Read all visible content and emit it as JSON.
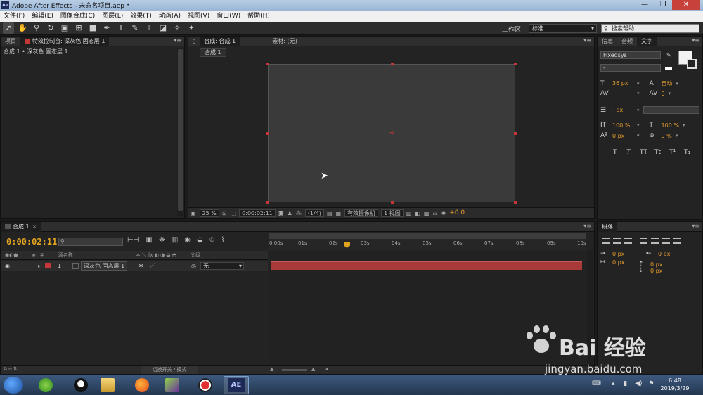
{
  "window": {
    "app_icon": "Ae",
    "title": "Adobe After Effects - 未命名项目.aep *",
    "min": "—",
    "max": "❐",
    "close": "✕"
  },
  "menu": [
    "文件(F)",
    "编辑(E)",
    "图像合成(C)",
    "图层(L)",
    "效果(T)",
    "动画(A)",
    "视图(V)",
    "窗口(W)",
    "帮助(H)"
  ],
  "toolbar": {
    "workspace_label": "工作区:",
    "workspace_value": "标准",
    "help_placeholder": "搜索帮助"
  },
  "project_panel": {
    "tab_project": "项目",
    "tab_effects": "特效控制台: 深灰色 固态层 1",
    "subtitle": "合成 1 • 深灰色 固态层 1"
  },
  "viewer_panel": {
    "tab_comp": "合成: 合成 1",
    "tab_footage": "素材: (无)",
    "comp_chip": "合成 1",
    "zoom": "25 %",
    "timecode": "0:00:02:11",
    "resolution": "(1/4)",
    "camera": "有效摄像机",
    "views": "1 视图",
    "exposure": "+0.0"
  },
  "right_panel": {
    "tab_info": "信息",
    "tab_audio": "音频",
    "tab_text": "文字",
    "font_family": "Fixedsys",
    "font_style": "-",
    "font_size": "36 px",
    "leading": "自动",
    "kerning": "",
    "tracking": "0",
    "stroke_width": "- px",
    "vscale": "100 %",
    "hscale": "100 %",
    "baseline": "0 px",
    "tsume": "0 %",
    "styles": [
      "T",
      "T",
      "TT",
      "Tt",
      "T¹",
      "T₁"
    ]
  },
  "timeline": {
    "tab": "合成 1",
    "timecode": "0:00:02:11",
    "col_source": "源名称",
    "col_parent": "父级",
    "layer_num": "1",
    "layer_name": "深灰色 固态层 1",
    "parent_value": "无",
    "ticks": [
      "0:00s",
      "01s",
      "02s",
      "03s",
      "04s",
      "05s",
      "06s",
      "07s",
      "08s",
      "09s",
      "10s"
    ],
    "bottom_toggle": "切换开关 / 模式"
  },
  "paragraph_panel": {
    "tab": "段落",
    "indent_left": "0 px",
    "indent_right": "0 px",
    "indent_first": "0 px",
    "space_before": "0 px",
    "space_after": "0 px"
  },
  "taskbar": {
    "time": "6:48",
    "date": "2019/3/29",
    "ae_label": "AE"
  },
  "watermark": {
    "logo": "Bai 经验",
    "url": "jingyan.baidu.com"
  },
  "colors": {
    "accent_orange": "#e29b2e",
    "layer_red": "#a83a3a",
    "cti": "#c43838"
  }
}
